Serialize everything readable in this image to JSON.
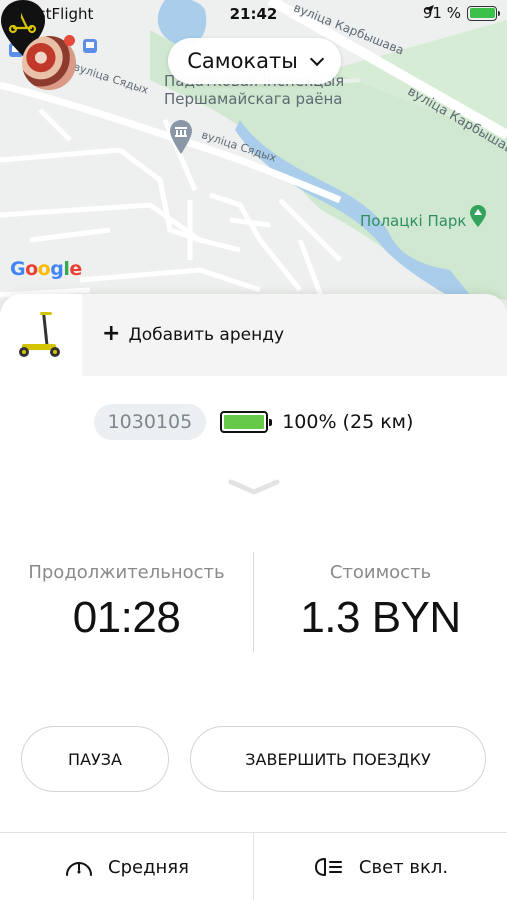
{
  "status_bar": {
    "carrier": "TestFlight",
    "time": "21:42",
    "battery_percent": "91 %",
    "battery_color": "#3bc14a"
  },
  "map": {
    "labels": {
      "tax_office_line1": "Падатковая інспекцыя",
      "tax_office_line2": "Першамайскага раёна",
      "street_karbysheva_top": "вуліца Карбышава",
      "street_karbysheva_right": "вуліца Карбышава",
      "street_syadykh_left": "вуліца Сядых",
      "street_syadykh_center": "вуліца Сядых",
      "park": "Полацкі Парк"
    },
    "google_letters": [
      "G",
      "o",
      "o",
      "g",
      "l",
      "e"
    ]
  },
  "selector": {
    "label": "Самокаты",
    "icon": "chevron-down-icon"
  },
  "rental": {
    "add_icon": "+",
    "add_label": "Добавить аренду"
  },
  "vehicle": {
    "id": "1030105",
    "battery_level": 1.0,
    "battery_text": "100% (25 км)",
    "battery_color": "#66c94a"
  },
  "stats": {
    "duration_label": "Продолжительность",
    "duration_value": "01:28",
    "cost_label": "Стоимость",
    "cost_value": "1.3 BYN"
  },
  "actions": {
    "pause_label": "ПАУЗА",
    "finish_label": "ЗАВЕРШИТЬ ПОЕЗДКУ"
  },
  "bottom_bar": {
    "speed_icon": "speedometer-icon",
    "speed_label": "Средняя",
    "light_icon": "headlight-icon",
    "light_label": "Свет вкл."
  },
  "colors": {
    "accent_green": "#66c94a",
    "park_green": "#c8e6c9",
    "water_blue": "#a9cdeb",
    "scooter_yellow": "#d4c400"
  }
}
